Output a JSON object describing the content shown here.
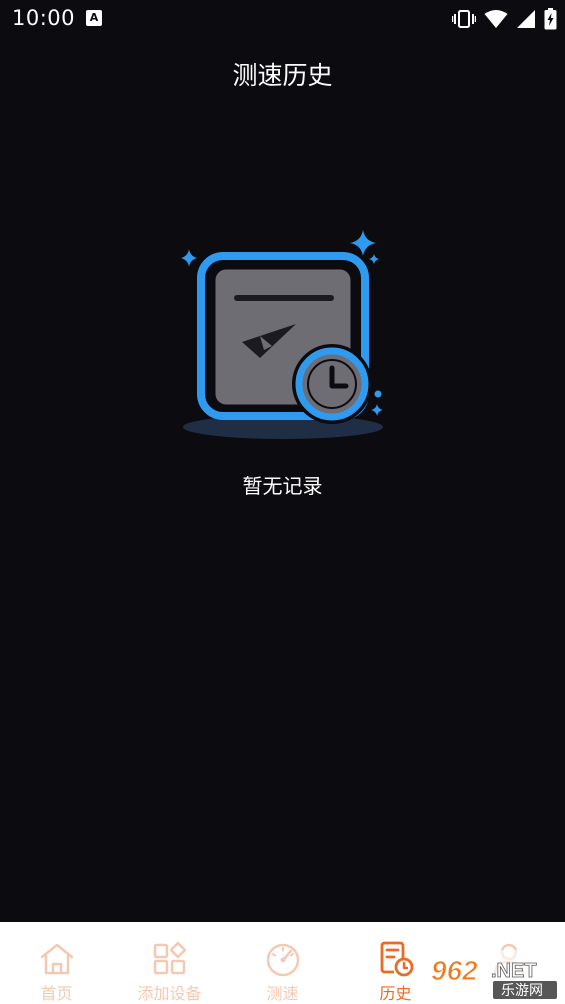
{
  "status_bar": {
    "time": "10:00",
    "app_icon_letter": "A",
    "icons": [
      "vibrate-icon",
      "wifi-icon",
      "signal-icon",
      "battery-icon"
    ]
  },
  "header": {
    "title": "测速历史"
  },
  "empty_state": {
    "icon": "history-empty-icon",
    "message": "暂无记录"
  },
  "tab_bar": {
    "active_tab": "history",
    "tabs": [
      {
        "id": "home",
        "label": "首页",
        "icon": "home-icon"
      },
      {
        "id": "add-device",
        "label": "添加设备",
        "icon": "grid-plus-icon"
      },
      {
        "id": "speed-test",
        "label": "测速",
        "icon": "speedometer-icon"
      },
      {
        "id": "history",
        "label": "历史",
        "icon": "history-doc-icon"
      },
      {
        "id": "profile",
        "label": "",
        "icon": "user-icon"
      }
    ]
  },
  "watermark": {
    "brand": "962.NET",
    "subtitle": "乐游网"
  },
  "colors": {
    "background": "#0b0b10",
    "accent_blue": "#2e9bf0",
    "tab_active": "#e96b24",
    "tab_inactive": "#f4c9b2",
    "watermark_orange": "#f07a1c"
  }
}
